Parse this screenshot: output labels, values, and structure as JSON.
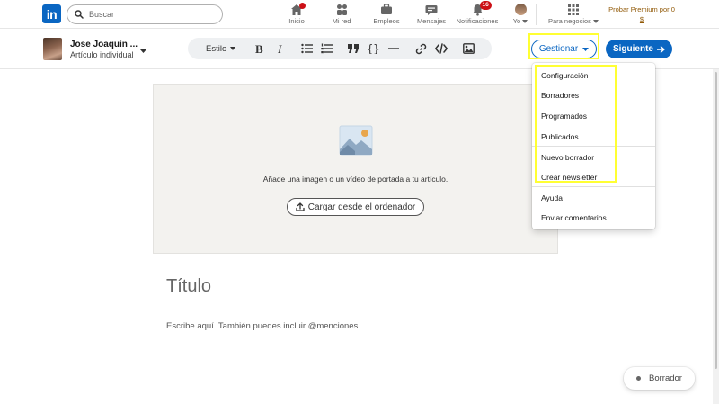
{
  "nav": {
    "logo_text": "in",
    "search_placeholder": "Buscar",
    "items": [
      {
        "label": "Inicio",
        "icon": "home-icon"
      },
      {
        "label": "Mi red",
        "icon": "network-icon"
      },
      {
        "label": "Empleos",
        "icon": "briefcase-icon"
      },
      {
        "label": "Mensajes",
        "icon": "messaging-icon"
      },
      {
        "label": "Notificaciones",
        "icon": "bell-icon",
        "badge": "16"
      },
      {
        "label": "Yo",
        "icon": "avatar"
      },
      {
        "label": "Para negocios",
        "icon": "grid-icon"
      }
    ],
    "premium_text": "Probar Premium por 0 $"
  },
  "editor": {
    "author_name": "Jose Joaquin ...",
    "author_type": "Artículo individual",
    "style_label": "Estilo",
    "manage_label": "Gestionar",
    "next_label": "Siguiente"
  },
  "cover": {
    "prompt": "Añade una imagen o un vídeo de portada a tu artículo.",
    "upload_label": "Cargar desde el ordenador"
  },
  "article": {
    "title_placeholder": "Título",
    "body_placeholder": "Escribe aquí. También puedes incluir @menciones."
  },
  "menu": {
    "items": [
      "Configuración",
      "Borradores",
      "Programados",
      "Publicados",
      "Nuevo borrador",
      "Crear newsletter",
      "Ayuda",
      "Enviar comentarios"
    ]
  },
  "draft_status": "Borrador",
  "colors": {
    "brand": "#0a66c2",
    "highlight": "#ffff33",
    "notification": "#cc1016",
    "premium": "#915907"
  }
}
